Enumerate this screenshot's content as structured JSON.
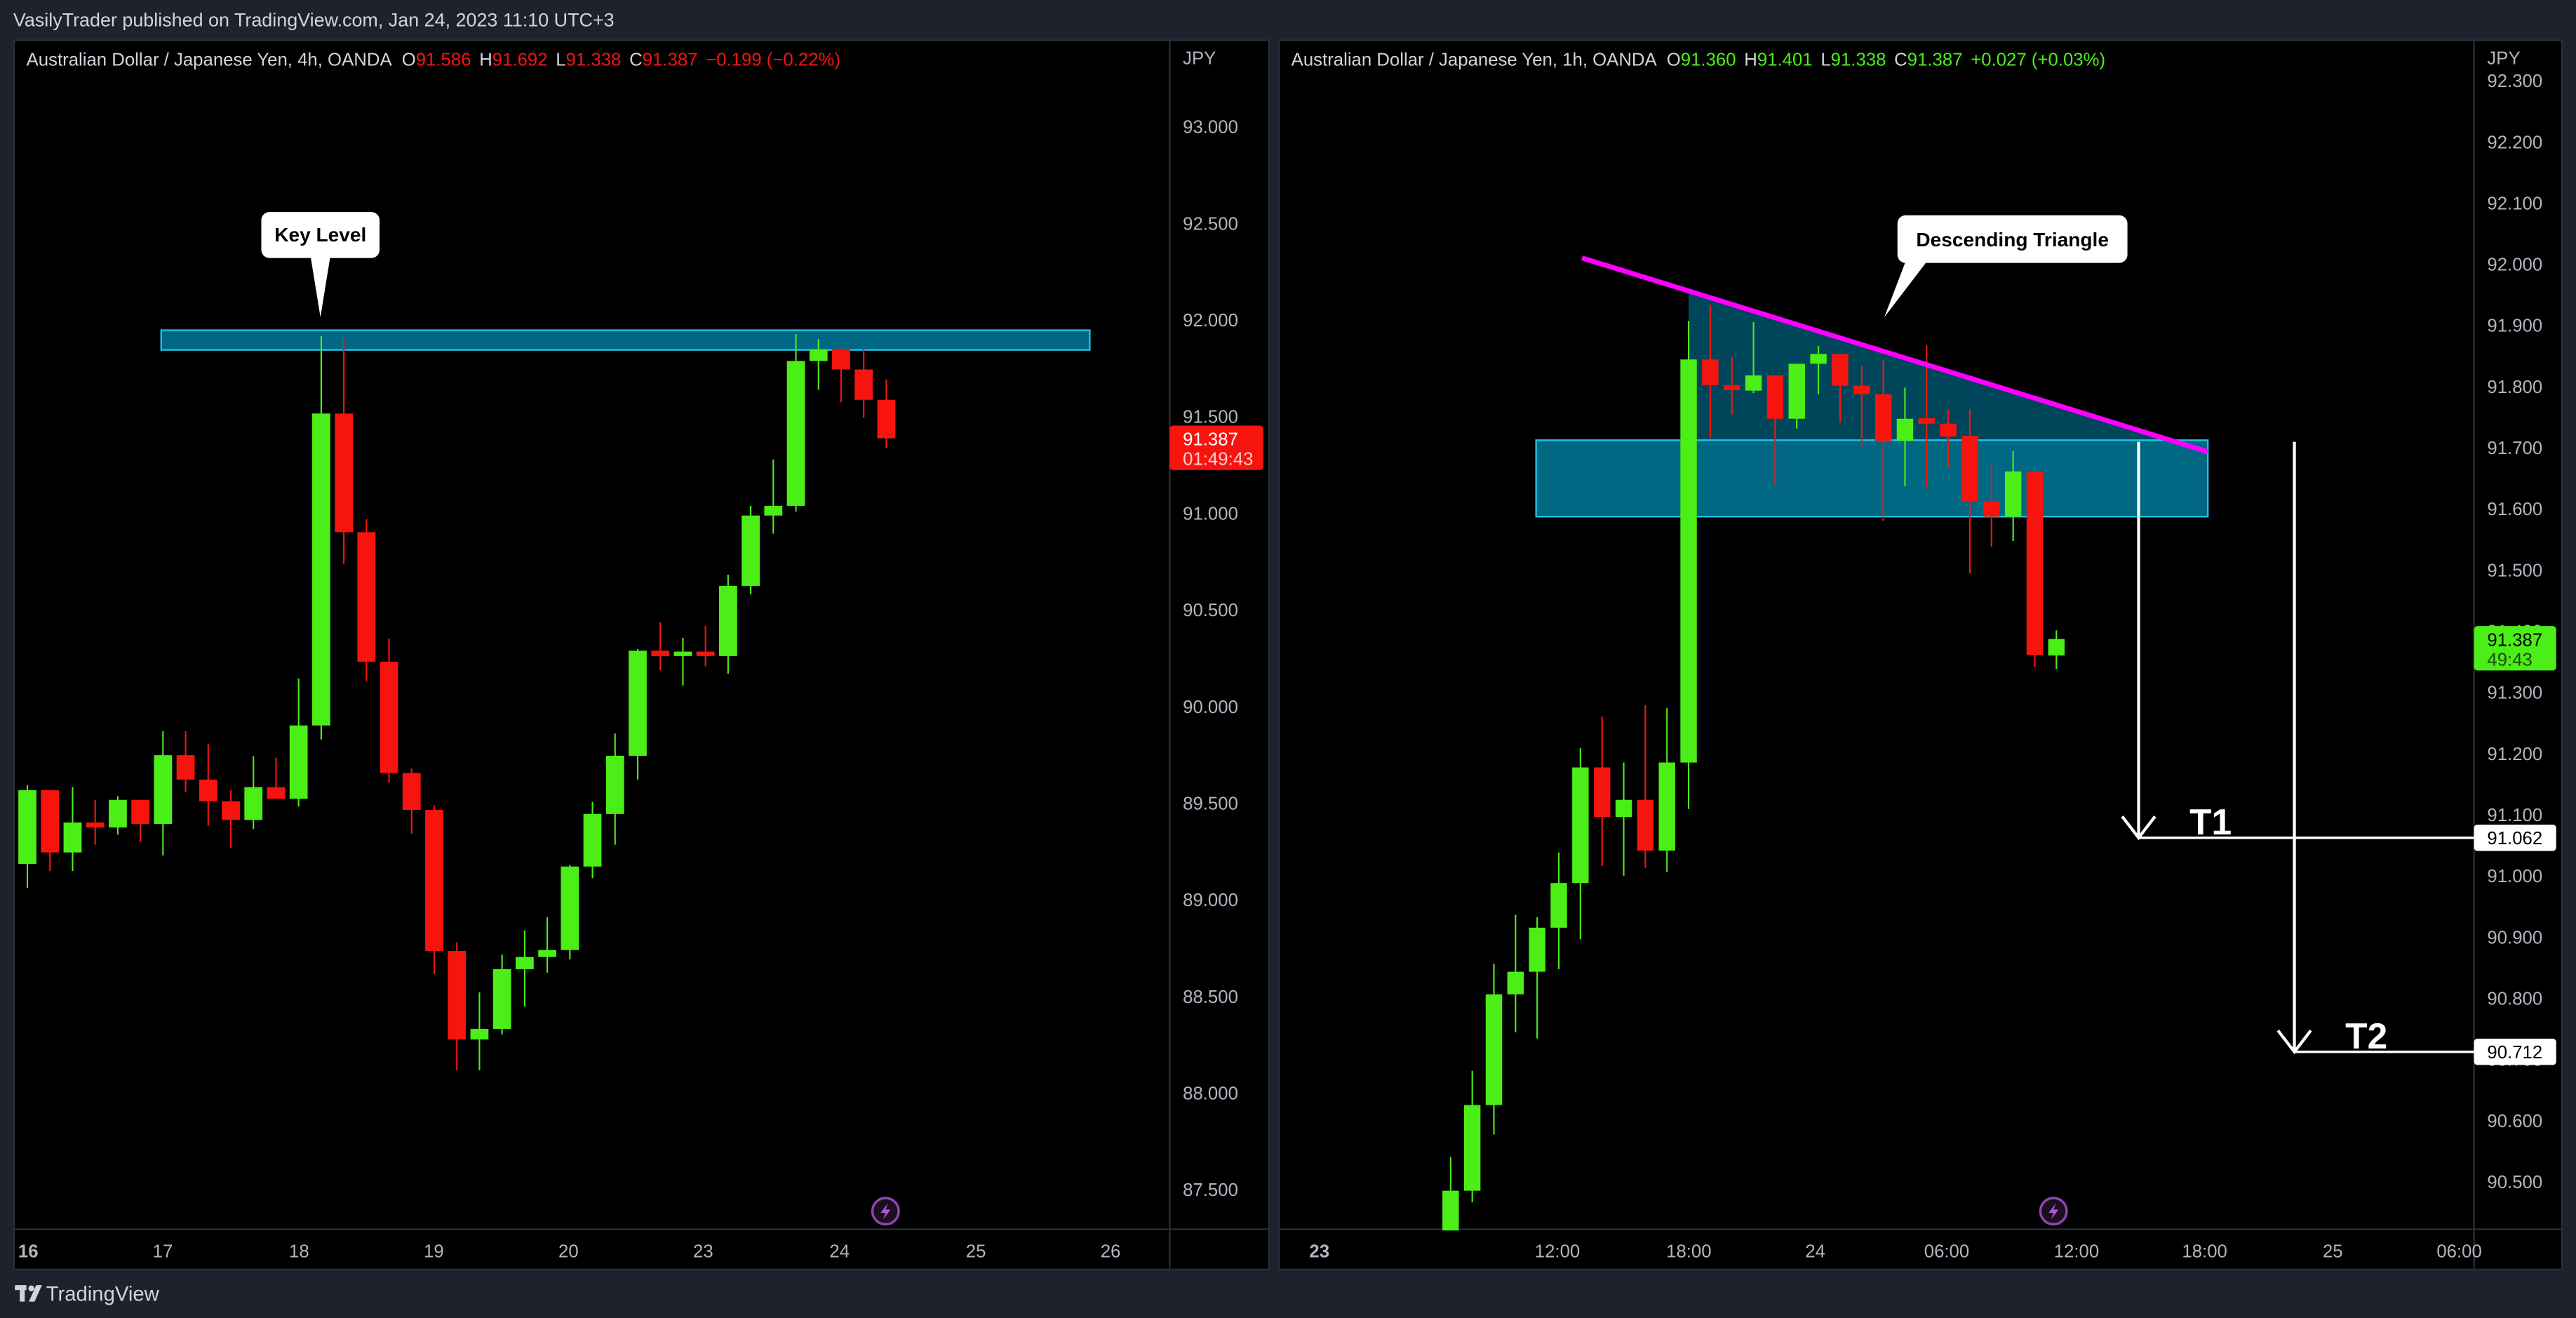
{
  "header": {
    "title": "VasilyTrader published on TradingView.com, Jan 24, 2023 11:10 UTC+3"
  },
  "footer": {
    "logo_text": "TradingView"
  },
  "colors": {
    "up": "#4cee18",
    "down": "#f7140f",
    "zone": "#006883",
    "zone_border": "#22c4e8",
    "trendline": "#ff00ff",
    "triangle_fill": "#00465a",
    "background": "#000000",
    "chrome": "#1e222d"
  },
  "left_chart": {
    "symbol": "Australian Dollar / Japanese Yen, 4h, OANDA",
    "ohlc": {
      "o_label": "O",
      "o": "91.586",
      "h_label": "H",
      "h": "91.692",
      "l_label": "L",
      "l": "91.338",
      "c_label": "C",
      "c": "91.387",
      "change": "−0.199 (−0.22%)"
    },
    "currency": "JPY",
    "price_ticks": [
      "93.000",
      "92.500",
      "92.000",
      "91.500",
      "91.000",
      "90.500",
      "90.000",
      "89.500",
      "89.000",
      "88.500",
      "88.000",
      "87.500"
    ],
    "time_ticks": [
      "16",
      "17",
      "18",
      "19",
      "20",
      "23",
      "24",
      "25",
      "26"
    ],
    "last_price": "91.387",
    "countdown": "01:49:43",
    "key_level_zone": [
      91.844,
      91.946
    ],
    "callout": "Key Level",
    "chart_data": {
      "type": "candlestick",
      "interval": "4h",
      "open": [
        89.184,
        89.566,
        89.244,
        89.399,
        89.373,
        89.516,
        89.391,
        89.747,
        89.621,
        89.509,
        89.412,
        89.582,
        89.522,
        89.901,
        91.515,
        90.901,
        90.231,
        89.655,
        89.464,
        88.734,
        88.276,
        88.331,
        88.64,
        88.703,
        88.739,
        89.171,
        89.443,
        89.744,
        90.288,
        90.26,
        90.283,
        90.26,
        90.623,
        90.987,
        91.037,
        91.787,
        91.848,
        91.743,
        91.586
      ],
      "high": [
        89.592,
        89.566,
        89.582,
        89.516,
        89.535,
        89.516,
        89.872,
        89.872,
        89.807,
        89.566,
        89.742,
        89.734,
        90.144,
        91.916,
        91.895,
        90.969,
        90.351,
        89.679,
        89.488,
        88.779,
        88.52,
        88.716,
        88.841,
        88.909,
        89.179,
        89.506,
        89.859,
        90.296,
        90.435,
        90.354,
        90.416,
        90.681,
        91.037,
        91.277,
        91.926,
        91.9,
        91.858,
        91.858,
        91.692
      ],
      "low": [
        89.061,
        89.148,
        89.148,
        89.284,
        89.336,
        89.297,
        89.229,
        89.558,
        89.383,
        89.268,
        89.365,
        89.522,
        89.482,
        89.828,
        90.736,
        90.129,
        89.605,
        89.341,
        88.614,
        88.117,
        88.117,
        88.302,
        88.446,
        88.622,
        88.69,
        89.111,
        89.284,
        89.621,
        90.186,
        90.108,
        90.207,
        90.168,
        90.579,
        90.893,
        91.008,
        91.638,
        91.573,
        91.494,
        91.338
      ],
      "close": [
        89.566,
        89.244,
        89.399,
        89.373,
        89.516,
        89.391,
        89.747,
        89.621,
        89.509,
        89.412,
        89.582,
        89.522,
        89.901,
        91.515,
        90.901,
        90.231,
        89.655,
        89.464,
        88.734,
        88.276,
        88.331,
        88.64,
        88.703,
        88.739,
        89.171,
        89.443,
        89.744,
        90.288,
        90.26,
        90.283,
        90.26,
        90.623,
        90.987,
        91.037,
        91.787,
        91.848,
        91.743,
        91.586,
        91.387
      ],
      "ylim": [
        87.4,
        93.3
      ]
    }
  },
  "right_chart": {
    "symbol": "Australian Dollar / Japanese Yen, 1h, OANDA",
    "ohlc": {
      "o_label": "O",
      "o": "91.360",
      "h_label": "H",
      "h": "91.401",
      "l_label": "L",
      "l": "91.338",
      "c_label": "C",
      "c": "91.387",
      "change": "+0.027 (+0.03%)"
    },
    "currency": "JPY",
    "price_ticks": [
      "92.300",
      "92.200",
      "92.100",
      "92.000",
      "91.900",
      "91.800",
      "91.700",
      "91.600",
      "91.500",
      "91.400",
      "91.300",
      "91.200",
      "91.100",
      "91.000",
      "90.900",
      "90.800",
      "90.700",
      "90.600",
      "90.500"
    ],
    "time_ticks": [
      "23",
      "12:00",
      "18:00",
      "24",
      "06:00",
      "12:00",
      "18:00",
      "25",
      "06:00"
    ],
    "last_price": "91.387",
    "countdown": "49:43",
    "zone": [
      91.587,
      91.712
    ],
    "trendline": [
      92.01,
      91.693
    ],
    "callout": "Descending Triangle",
    "targets": [
      {
        "label": "T1",
        "price": "91.062"
      },
      {
        "label": "T2",
        "price": "90.712"
      }
    ],
    "chart_data": {
      "type": "candlestick",
      "interval": "1h",
      "open": [
        90.42,
        90.485,
        90.625,
        90.806,
        90.843,
        90.915,
        90.988,
        91.177,
        91.096,
        91.124,
        91.041,
        91.185,
        91.844,
        91.802,
        91.793,
        91.818,
        91.747,
        91.837,
        91.853,
        91.801,
        91.787,
        91.711,
        91.748,
        91.739,
        91.719,
        91.612,
        91.587,
        91.661,
        91.36
      ],
      "high": [
        90.54,
        90.681,
        90.856,
        90.936,
        90.932,
        91.038,
        91.209,
        91.26,
        91.185,
        91.279,
        91.274,
        91.907,
        91.933,
        91.848,
        91.905,
        91.818,
        91.837,
        91.866,
        91.853,
        91.834,
        91.843,
        91.798,
        91.867,
        91.762,
        91.762,
        91.675,
        91.694,
        91.661,
        91.401
      ],
      "low": [
        90.42,
        90.466,
        90.577,
        90.744,
        90.734,
        90.847,
        90.896,
        91.016,
        91.0,
        91.013,
        91.006,
        91.109,
        91.716,
        91.754,
        91.789,
        91.638,
        91.731,
        91.787,
        91.741,
        91.702,
        91.58,
        91.637,
        91.635,
        91.668,
        91.494,
        91.538,
        91.547,
        91.341,
        91.338
      ],
      "close": [
        90.485,
        90.625,
        90.806,
        90.843,
        90.915,
        90.988,
        91.177,
        91.096,
        91.124,
        91.041,
        91.185,
        91.844,
        91.802,
        91.794,
        91.818,
        91.747,
        91.837,
        91.853,
        91.801,
        91.787,
        91.711,
        91.747,
        91.739,
        91.718,
        91.612,
        91.587,
        91.661,
        91.361,
        91.387
      ],
      "ylim": [
        90.45,
        92.35
      ]
    }
  }
}
